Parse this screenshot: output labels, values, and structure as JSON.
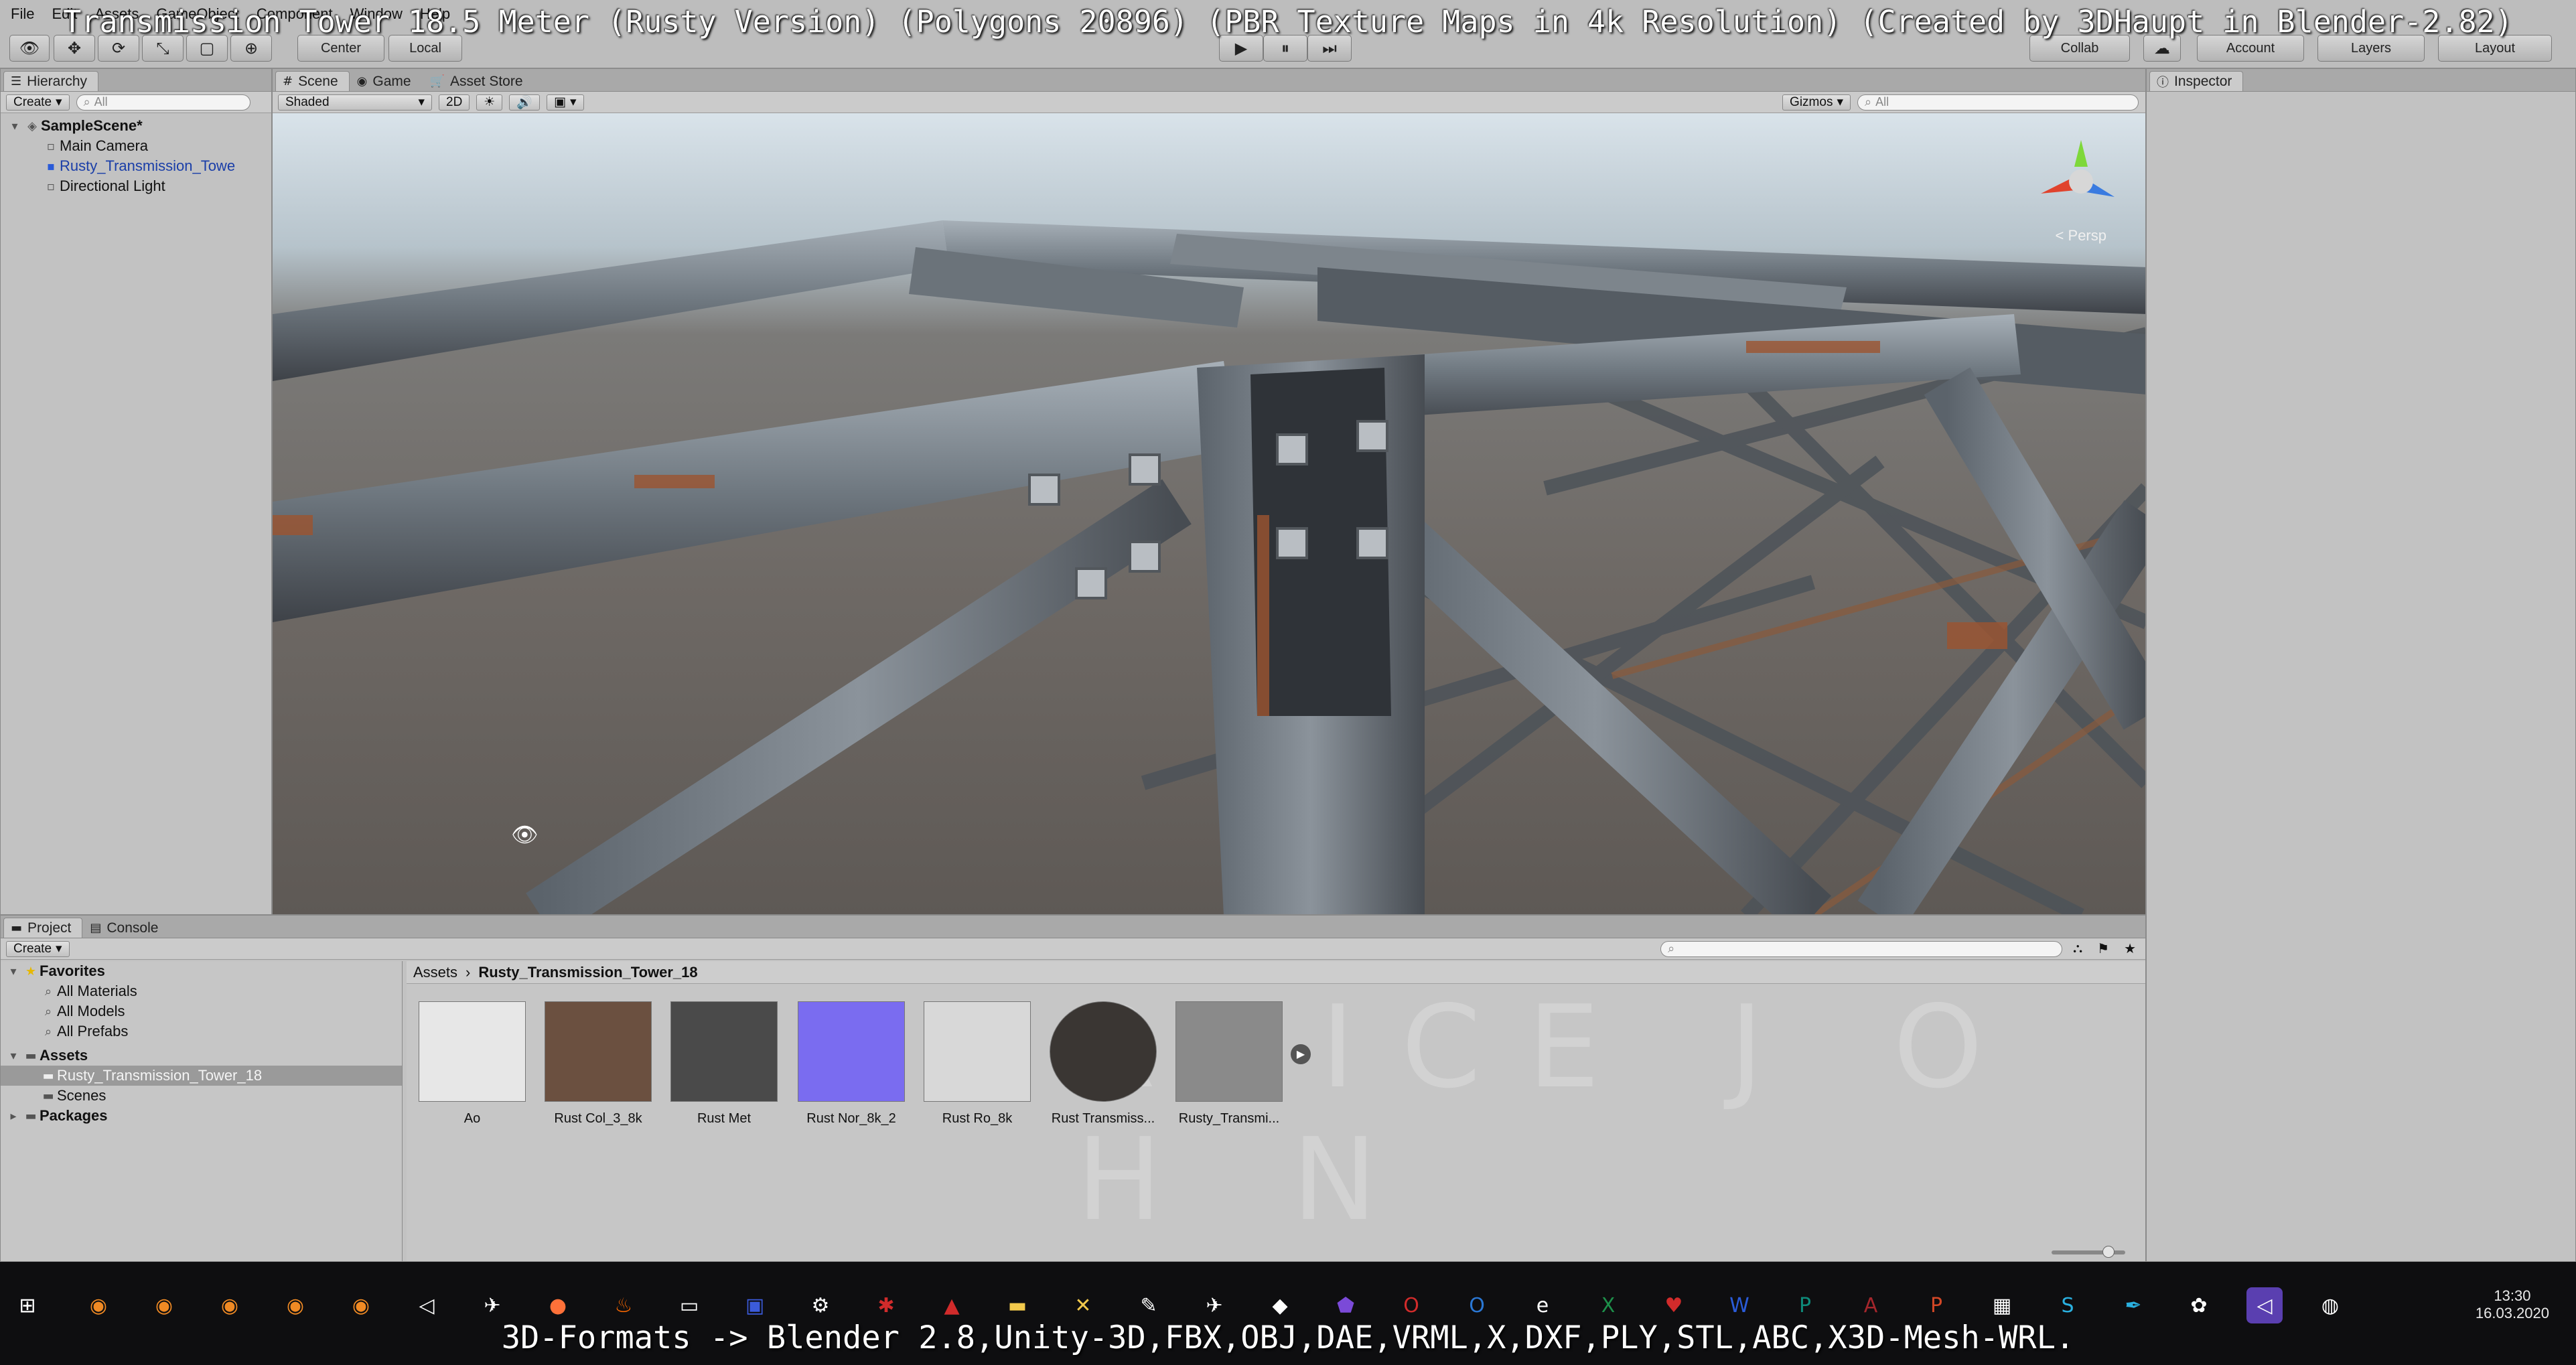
{
  "overlay_title": "Transmission Tower 18.5 Meter (Rusty Version) (Polygons 20896) (PBR Texture Maps in 4k Resolution) (Created by 3DHaupt in Blender-2.82)",
  "menu": [
    "File",
    "Edit",
    "Assets",
    "GameObject",
    "Component",
    "Window",
    "Help"
  ],
  "toolbar": {
    "pivot": "Center",
    "space": "Local",
    "collab": "Collab",
    "account": "Account",
    "layers": "Layers",
    "layout": "Layout"
  },
  "hierarchy": {
    "tab": "Hierarchy",
    "create": "Create",
    "search_placeholder": "All",
    "scene": "SampleScene*",
    "items": [
      {
        "label": "Main Camera"
      },
      {
        "label": "Rusty_Transmission_Towe"
      },
      {
        "label": "Directional Light"
      }
    ]
  },
  "scene": {
    "tabs": [
      "Scene",
      "Game",
      "Asset Store"
    ],
    "shading": "Shaded",
    "mode_2d": "2D",
    "gizmos": "Gizmos",
    "search_placeholder": "All",
    "persp": "Persp"
  },
  "inspector": {
    "tab": "Inspector"
  },
  "project": {
    "tabs": [
      "Project",
      "Console"
    ],
    "create": "Create",
    "favorites": {
      "label": "Favorites",
      "items": [
        "All Materials",
        "All Models",
        "All Prefabs"
      ]
    },
    "assets": {
      "label": "Assets",
      "items": [
        "Rusty_Transmission_Tower_18",
        "Scenes"
      ]
    },
    "packages": "Packages",
    "breadcrumb": [
      "Assets",
      "Rusty_Transmission_Tower_18"
    ],
    "thumbnails": [
      {
        "label": "Ao",
        "color": "#e7e7e7"
      },
      {
        "label": "Rust Col_3_8k",
        "color": "#6b5040"
      },
      {
        "label": "Rust Met",
        "color": "#4a4a4a"
      },
      {
        "label": "Rust Nor_8k_2",
        "color": "#7a6cf0"
      },
      {
        "label": "Rust Ro_8k",
        "color": "#d8d8d8"
      },
      {
        "label": "Rust Transmiss...",
        "color": "#3a3633"
      },
      {
        "label": "Rusty_Transmi...",
        "color": "#8a8a8a"
      }
    ]
  },
  "watermark": "RVICE J O H N",
  "taskbar": {
    "time": "13:30",
    "date": "16.03.2020"
  },
  "bottom_caption": "3D-Formats -> Blender 2.8,Unity-3D,FBX,OBJ,DAE,VRML,X,DXF,PLY,STL,ABC,X3D-Mesh-WRL."
}
